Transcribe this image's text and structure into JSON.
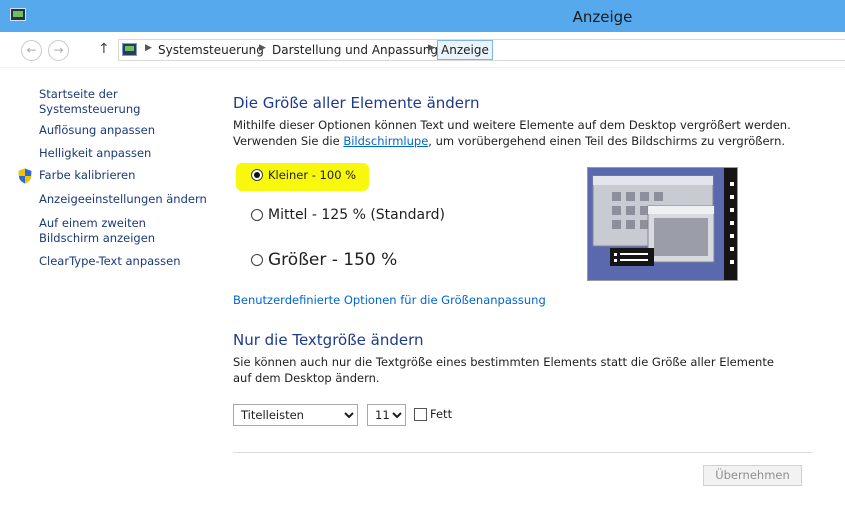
{
  "window": {
    "title": "Anzeige"
  },
  "nav": {
    "back_glyph": "←",
    "forward_glyph": "→",
    "up_glyph": "↑",
    "separator_glyph": "▶",
    "breadcrumbs": [
      "Systemsteuerung",
      "Darstellung und Anpassung",
      "Anzeige"
    ]
  },
  "sidebar": {
    "items": [
      {
        "label": "Startseite der Systemsteuerung"
      },
      {
        "label": "Auflösung anpassen"
      },
      {
        "label": "Helligkeit anpassen"
      },
      {
        "label": "Farbe kalibrieren"
      },
      {
        "label": "Anzeigeeinstellungen ändern"
      },
      {
        "label": "Auf einem zweiten Bildschirm anzeigen"
      },
      {
        "label": "ClearType-Text anpassen"
      }
    ]
  },
  "main": {
    "size_heading": "Die Größe aller Elemente ändern",
    "size_desc_before": "Mithilfe dieser Optionen können Text und weitere Elemente auf dem Desktop vergrößert werden. Verwenden Sie die ",
    "size_desc_link": "Bildschirmlupe",
    "size_desc_after": ", um vorübergehend einen Teil des Bildschirms zu vergrößern.",
    "options": [
      {
        "label": "Kleiner - 100 %",
        "selected": true
      },
      {
        "label": "Mittel - 125 % (Standard)",
        "selected": false
      },
      {
        "label": "Größer - 150 %",
        "selected": false
      }
    ],
    "custom_link": "Benutzerdefinierte Optionen für die Größenanpassung",
    "text_heading": "Nur die Textgröße ändern",
    "text_desc": "Sie können auch nur die Textgröße eines bestimmten Elements statt die Größe aller Elemente auf dem Desktop ändern.",
    "element_select": {
      "value": "Titelleisten"
    },
    "size_select": {
      "value": "11"
    },
    "bold_label": "Fett",
    "bold_checked": false,
    "apply_button": "Übernehmen"
  },
  "colors": {
    "titlebar": "#56a9ec",
    "heading": "#1e3a8a",
    "link": "#0066cc",
    "highlight": "#f8f80d",
    "preview_bg": "#5764a8"
  }
}
